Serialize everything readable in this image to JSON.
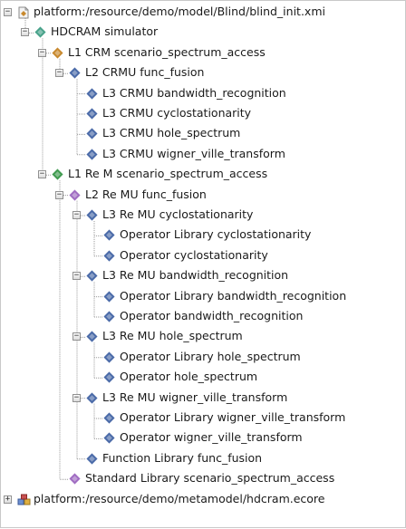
{
  "colors": {
    "line": "#9a9a9a",
    "diamond_blue": "#4a6aa8",
    "diamond_teal": "#48a28a",
    "diamond_orange": "#c8892e",
    "diamond_purple": "#a06cc2",
    "diamond_green": "#3f9a4f"
  },
  "tree": [
    {
      "label": "platform:/resource/demo/model/Blind/blind_init.xmi",
      "level": 0,
      "toggle": "-",
      "icon": "model-file-icon"
    },
    {
      "label": "HDCRAM simulator",
      "level": 1,
      "toggle": "-",
      "icon": "diamond-teal-icon"
    },
    {
      "label": "L1 CRM scenario_spectrum_access",
      "level": 2,
      "toggle": "-",
      "icon": "diamond-orange-icon"
    },
    {
      "label": "L2 CRMU func_fusion",
      "level": 3,
      "toggle": "-",
      "icon": "diamond-blue-icon"
    },
    {
      "label": "L3 CRMU bandwidth_recognition",
      "level": 4,
      "toggle": null,
      "icon": "diamond-blue-icon"
    },
    {
      "label": "L3 CRMU cyclostationarity",
      "level": 4,
      "toggle": null,
      "icon": "diamond-blue-icon"
    },
    {
      "label": "L3 CRMU hole_spectrum",
      "level": 4,
      "toggle": null,
      "icon": "diamond-blue-icon"
    },
    {
      "label": "L3 CRMU wigner_ville_transform",
      "level": 4,
      "toggle": null,
      "icon": "diamond-blue-icon"
    },
    {
      "label": "L1 Re M scenario_spectrum_access",
      "level": 2,
      "toggle": "-",
      "icon": "diamond-green-icon"
    },
    {
      "label": "L2 Re MU func_fusion",
      "level": 3,
      "toggle": "-",
      "icon": "diamond-purple-icon"
    },
    {
      "label": "L3 Re MU cyclostationarity",
      "level": 4,
      "toggle": "-",
      "icon": "diamond-blue-icon"
    },
    {
      "label": "Operator Library cyclostationarity",
      "level": 5,
      "toggle": null,
      "icon": "diamond-blue-icon"
    },
    {
      "label": "Operator cyclostationarity",
      "level": 5,
      "toggle": null,
      "icon": "diamond-blue-icon"
    },
    {
      "label": "L3 Re MU bandwidth_recognition",
      "level": 4,
      "toggle": "-",
      "icon": "diamond-blue-icon"
    },
    {
      "label": "Operator Library bandwidth_recognition",
      "level": 5,
      "toggle": null,
      "icon": "diamond-blue-icon"
    },
    {
      "label": "Operator bandwidth_recognition",
      "level": 5,
      "toggle": null,
      "icon": "diamond-blue-icon"
    },
    {
      "label": "L3 Re MU hole_spectrum",
      "level": 4,
      "toggle": "-",
      "icon": "diamond-blue-icon"
    },
    {
      "label": "Operator Library hole_spectrum",
      "level": 5,
      "toggle": null,
      "icon": "diamond-blue-icon"
    },
    {
      "label": "Operator hole_spectrum",
      "level": 5,
      "toggle": null,
      "icon": "diamond-blue-icon"
    },
    {
      "label": "L3 Re MU wigner_ville_transform",
      "level": 4,
      "toggle": "-",
      "icon": "diamond-blue-icon"
    },
    {
      "label": "Operator Library wigner_ville_transform",
      "level": 5,
      "toggle": null,
      "icon": "diamond-blue-icon"
    },
    {
      "label": "Operator wigner_ville_transform",
      "level": 5,
      "toggle": null,
      "icon": "diamond-blue-icon"
    },
    {
      "label": "Function Library func_fusion",
      "level": 4,
      "toggle": null,
      "icon": "diamond-blue-icon"
    },
    {
      "label": "Standard Library scenario_spectrum_access",
      "level": 3,
      "toggle": null,
      "icon": "diamond-purple-icon"
    },
    {
      "label": "platform:/resource/demo/metamodel/hdcram.ecore",
      "level": 0,
      "toggle": "+",
      "icon": "ecore-package-icon"
    }
  ]
}
